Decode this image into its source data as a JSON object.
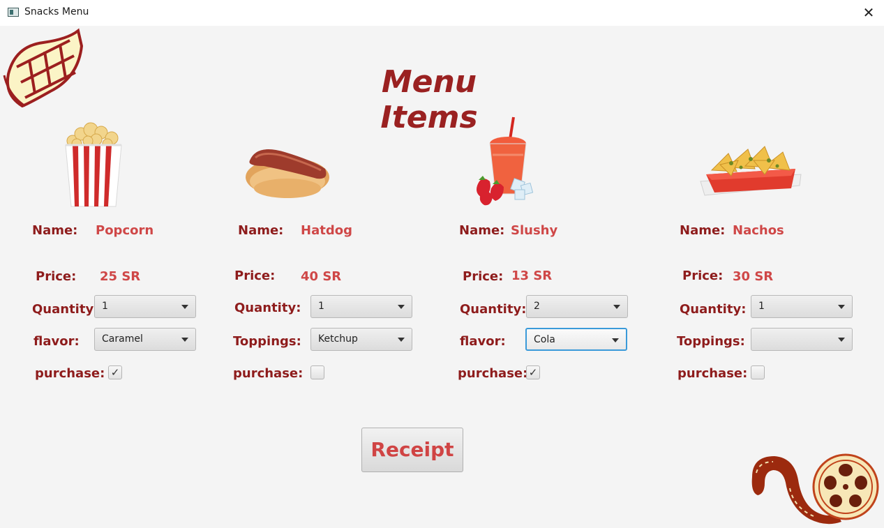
{
  "window": {
    "title": "Snacks Menu",
    "close_glyph": "✕"
  },
  "heading": "Menu Items",
  "items": [
    {
      "name_label": "Name:",
      "name": "Popcorn",
      "price_label": "Price:",
      "price": "25 SR",
      "quantity_label": "Quantity:",
      "quantity": "1",
      "option_label": "flavor:",
      "option": "Caramel",
      "purchase_label": "purchase:",
      "purchased": true,
      "image": "popcorn-image"
    },
    {
      "name_label": "Name:",
      "name": "Hatdog",
      "price_label": "Price:",
      "price": "40 SR",
      "quantity_label": "Quantity:",
      "quantity": "1",
      "option_label": "Toppings:",
      "option": "Ketchup",
      "purchase_label": "purchase:",
      "purchased": false,
      "image": "hotdog-image"
    },
    {
      "name_label": "Name:",
      "name": "Slushy",
      "price_label": "Price:",
      "price": "13 SR",
      "quantity_label": "Quantity:",
      "quantity": "2",
      "option_label": "flavor:",
      "option": "Cola",
      "purchase_label": "purchase:",
      "purchased": true,
      "image": "slushy-image"
    },
    {
      "name_label": "Name:",
      "name": "Nachos",
      "price_label": "Price:",
      "price": "30 SR",
      "quantity_label": "Quantity:",
      "quantity": "1",
      "option_label": "Toppings:",
      "option": "",
      "purchase_label": "purchase:",
      "purchased": false,
      "image": "nachos-image"
    }
  ],
  "receipt_button": "Receipt",
  "check_glyph": "✓",
  "colors": {
    "heading": "#9a2121",
    "label": "#8e1c1c",
    "value": "#cf4747",
    "focus": "#3a9ad9"
  }
}
